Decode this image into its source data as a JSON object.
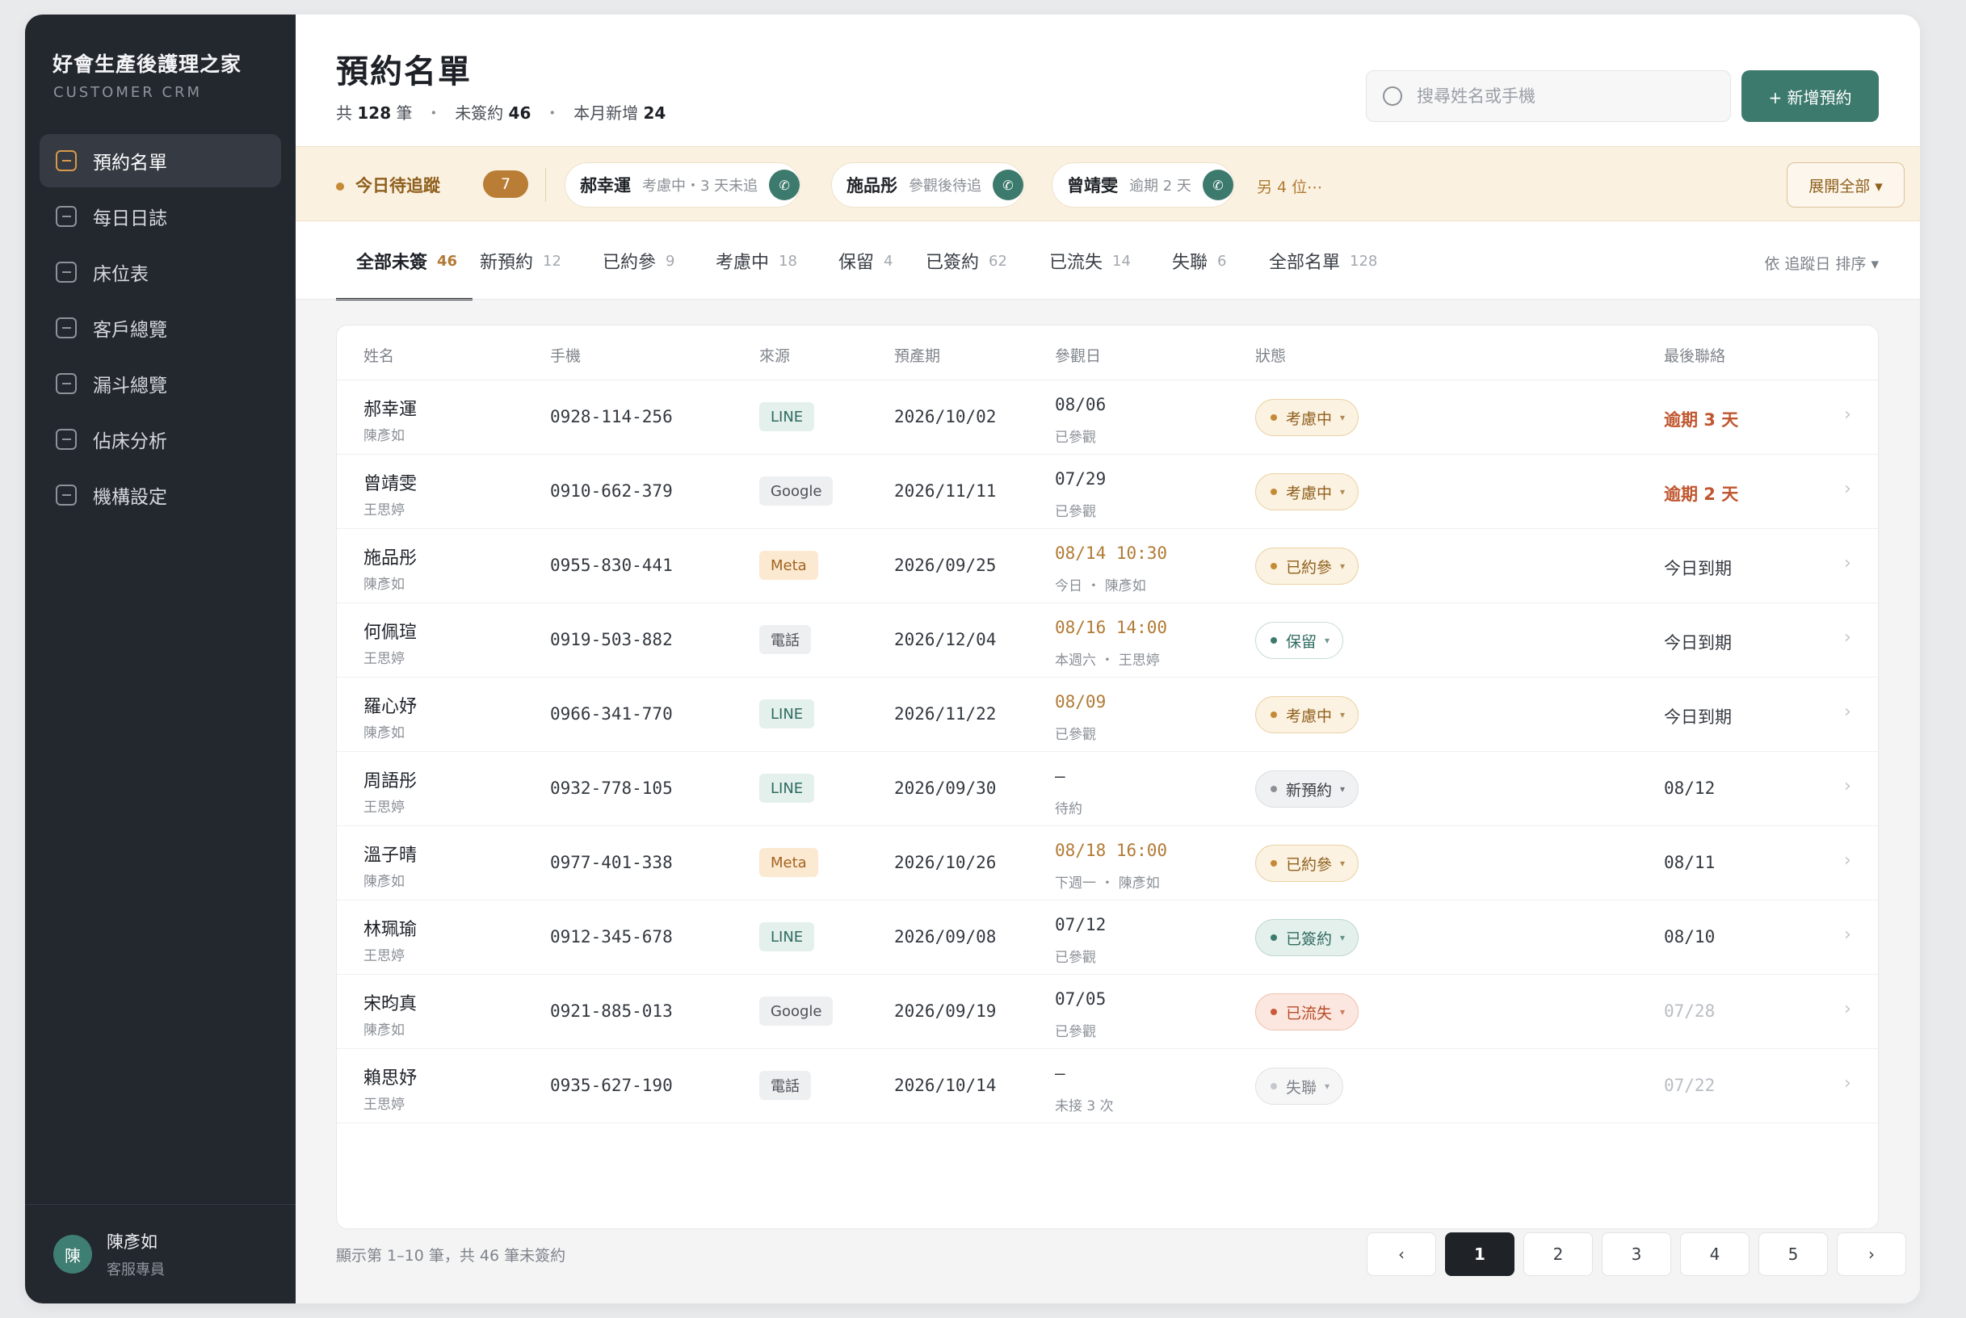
{
  "sidebar": {
    "brand_title": "好會生產後護理之家",
    "brand_sub": "CUSTOMER CRM",
    "items": [
      {
        "label": "預約名單"
      },
      {
        "label": "每日日誌"
      },
      {
        "label": "床位表"
      },
      {
        "label": "客戶總覽"
      },
      {
        "label": "漏斗總覽"
      },
      {
        "label": "佔床分析"
      },
      {
        "label": "機構設定"
      }
    ],
    "user": {
      "avatar": "陳",
      "name": "陳彥如",
      "role": "客服專員"
    }
  },
  "header": {
    "title": "預約名單",
    "summary": {
      "total_prefix": "共",
      "total": "128",
      "total_unit": "筆",
      "unsigned_label": "未簽約",
      "unsigned": "46",
      "new_label": "本月新增",
      "new": "24",
      "sep": "・"
    },
    "search_placeholder": "搜尋姓名或手機",
    "new_button": "+ 新增預約"
  },
  "followup": {
    "label": "今日待追蹤",
    "count": "7",
    "chips": [
      {
        "name": "郝幸運",
        "note": "考慮中・3 天未追"
      },
      {
        "name": "施品彤",
        "note": "參觀後待追"
      },
      {
        "name": "曾靖雯",
        "note": "逾期 2 天"
      }
    ],
    "call_icon": "✆",
    "more": "另 4 位⋯",
    "expand_button": "展開全部 ▾"
  },
  "tabs": [
    {
      "label": "全部未簽",
      "count": "46"
    },
    {
      "label": "新預約",
      "count": "12"
    },
    {
      "label": "已約參",
      "count": "9"
    },
    {
      "label": "考慮中",
      "count": "18"
    },
    {
      "label": "保留",
      "count": "4"
    },
    {
      "label": "已簽約",
      "count": "62"
    },
    {
      "label": "已流失",
      "count": "14"
    },
    {
      "label": "失聯",
      "count": "6"
    },
    {
      "label": "全部名單",
      "count": "128"
    }
  ],
  "sort_label": "依 追蹤日 排序  ▾",
  "table": {
    "headers": {
      "name": "姓名",
      "phone": "手機",
      "source": "來源",
      "due": "預產期",
      "visit": "參觀日",
      "status": "狀態",
      "last": "最後聯絡"
    },
    "rows": [
      {
        "name": "郝幸運",
        "owner": "陳彥如",
        "phone": "0928-114-256",
        "source": "LINE",
        "due": "2026/10/02",
        "visit": "08/06",
        "visit_sub": "已參觀",
        "status": "考慮中",
        "last": "逾期 3 天"
      },
      {
        "name": "曾靖雯",
        "owner": "王思婷",
        "phone": "0910-662-379",
        "source": "Google",
        "due": "2026/11/11",
        "visit": "07/29",
        "visit_sub": "已參觀",
        "status": "考慮中",
        "last": "逾期 2 天"
      },
      {
        "name": "施品彤",
        "owner": "陳彥如",
        "phone": "0955-830-441",
        "source": "Meta",
        "due": "2026/09/25",
        "visit": "08/14 10:30",
        "visit_sub": "今日 ・ 陳彥如",
        "status": "已約參",
        "last": "今日到期"
      },
      {
        "name": "何佩瑄",
        "owner": "王思婷",
        "phone": "0919-503-882",
        "source": "電話",
        "due": "2026/12/04",
        "visit": "08/16 14:00",
        "visit_sub": "本週六 ・ 王思婷",
        "status": "保留",
        "last": "今日到期"
      },
      {
        "name": "羅心妤",
        "owner": "陳彥如",
        "phone": "0966-341-770",
        "source": "LINE",
        "due": "2026/11/22",
        "visit": "08/09",
        "visit_sub": "已參觀",
        "status": "考慮中",
        "last": "今日到期"
      },
      {
        "name": "周語彤",
        "owner": "王思婷",
        "phone": "0932-778-105",
        "source": "LINE",
        "due": "2026/09/30",
        "visit": "—",
        "visit_sub": "待約",
        "status": "新預約",
        "last": "08/12"
      },
      {
        "name": "溫子晴",
        "owner": "陳彥如",
        "phone": "0977-401-338",
        "source": "Meta",
        "due": "2026/10/26",
        "visit": "08/18 16:00",
        "visit_sub": "下週一 ・ 陳彥如",
        "status": "已約參",
        "last": "08/11"
      },
      {
        "name": "林珮瑜",
        "owner": "王思婷",
        "phone": "0912-345-678",
        "source": "LINE",
        "due": "2026/09/08",
        "visit": "07/12",
        "visit_sub": "已參觀",
        "status": "已簽約",
        "last": "08/10"
      },
      {
        "name": "宋昀真",
        "owner": "陳彥如",
        "phone": "0921-885-013",
        "source": "Google",
        "due": "2026/09/19",
        "visit": "07/05",
        "visit_sub": "已參觀",
        "status": "已流失",
        "last": "07/28"
      },
      {
        "name": "賴思妤",
        "owner": "王思婷",
        "phone": "0935-627-190",
        "source": "電話",
        "due": "2026/10/14",
        "visit": "—",
        "visit_sub": "未接 3 次",
        "status": "失聯",
        "last": "07/22"
      }
    ]
  },
  "pagination": {
    "range_text": "顯示第 1–10 筆，共 46 筆未簽約",
    "prev": "‹",
    "pages": [
      "1",
      "2",
      "3",
      "4",
      "5"
    ],
    "next": "›",
    "current": "1"
  },
  "chevron": "›",
  "caret": "▾",
  "colors": {
    "primary": "#3d7a6e",
    "accent": "#b27a34",
    "sidebar": "#23272e",
    "overdue": "#c0562f"
  }
}
